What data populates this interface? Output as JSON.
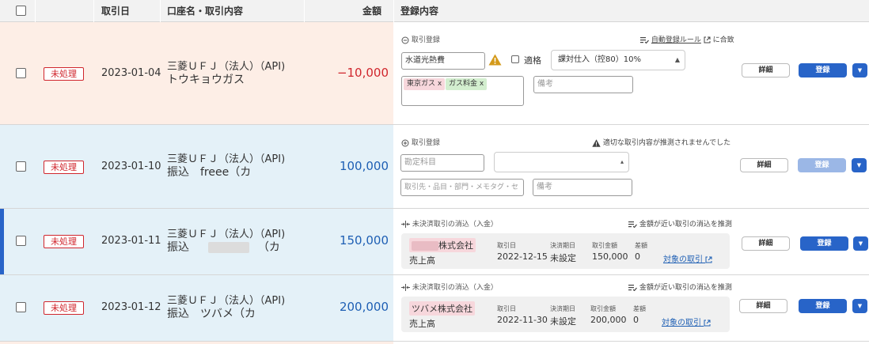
{
  "header": {
    "col_date": "取引日",
    "col_account": "口座名・取引内容",
    "col_amount": "金額",
    "col_registration": "登録内容"
  },
  "colors": {
    "row_bg_warning": "#fdeee6",
    "row_bg_info": "#e4f1f8",
    "primary": "#2864c8",
    "negative": "#d0262d",
    "positive": "#1e5fb4",
    "tag_pink": "#f7d7dc",
    "tag_green": "#d3eecf"
  },
  "rows": [
    {
      "status": "未処理",
      "date": "2023-01-04",
      "account": "三菱ＵＦＪ（法人）（API)",
      "description": "トウキョウガス",
      "amount": "−10,000",
      "section_label": "取引登録",
      "auto_rule_link": "自動登録ルール",
      "auto_rule_suffix": "に合致",
      "account_item_value": "水道光熱費",
      "qualified_label": "適格",
      "tax_value": "課対仕入（控80）10%",
      "tags": [
        "東京ガス x",
        "ガス料金 x"
      ],
      "memo_placeholder": "備考",
      "detail_label": "詳細",
      "register_label": "登録"
    },
    {
      "status": "未処理",
      "date": "2023-01-10",
      "account": "三菱ＵＦＪ（法人）（API)",
      "description": "振込　freee（カ",
      "amount": "100,000",
      "section_label": "取引登録",
      "warning_text": "適切な取引内容が推測されませんでした",
      "account_item_placeholder": "勘定科目",
      "partner_placeholder": "取引先・品目・部門・メモタグ・セ",
      "memo_placeholder": "備考",
      "detail_label": "詳細",
      "register_label": "登録"
    },
    {
      "status": "未処理",
      "date": "2023-01-11",
      "account": "三菱ＵＦＪ（法人）（API)",
      "description_tail": "（カ",
      "description_prefix": "振込",
      "amount": "150,000",
      "section_label": "未決済取引の消込（入金）",
      "suggest_text": "金額が近い取引の消込を推測",
      "partner_suffix": "株式会社",
      "category": "売上高",
      "k_date": "取引日",
      "v_date": "2022-12-15",
      "k_due": "決済期日",
      "v_due": "未設定",
      "k_amount": "取引金額",
      "v_amount": "150,000",
      "k_diff": "差額",
      "v_diff": "0",
      "target_link": "対象の取引",
      "detail_label": "詳細",
      "register_label": "登録"
    },
    {
      "status": "未処理",
      "date": "2023-01-12",
      "account": "三菱ＵＦＪ（法人）（API)",
      "description": "振込　ツバメ（カ",
      "amount": "200,000",
      "section_label": "未決済取引の消込（入金）",
      "suggest_text": "金額が近い取引の消込を推測",
      "partner": "ツバメ株式会社",
      "category": "売上高",
      "k_date": "取引日",
      "v_date": "2022-11-30",
      "k_due": "決済期日",
      "v_due": "未設定",
      "k_amount": "取引金額",
      "v_amount": "200,000",
      "k_diff": "差額",
      "v_diff": "0",
      "target_link": "対象の取引",
      "detail_label": "詳細",
      "register_label": "登録"
    }
  ]
}
